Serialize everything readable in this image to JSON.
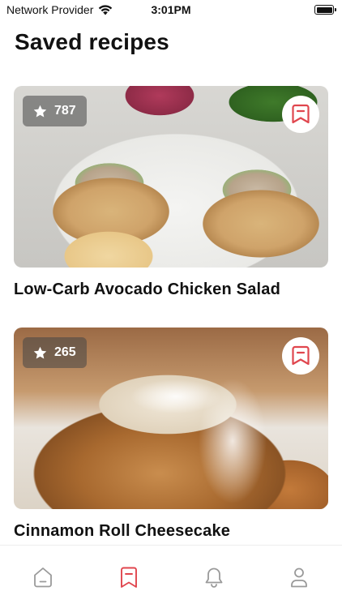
{
  "status_bar": {
    "carrier": "Network Provider",
    "time": "3:01PM",
    "wifi_icon": "wifi-icon",
    "battery_icon": "battery-icon"
  },
  "page": {
    "title": "Saved recipes"
  },
  "recipes": [
    {
      "title": "Low-Carb Avocado Chicken Salad",
      "rating": "787",
      "saved": true,
      "image_icon": "avocado-chicken-salad-photo"
    },
    {
      "title": "Cinnamon Roll Cheesecake",
      "rating": "265",
      "saved": true,
      "image_icon": "cinnamon-roll-cheesecake-photo"
    }
  ],
  "bottom_nav": {
    "items": [
      {
        "icon": "home-icon",
        "active": false
      },
      {
        "icon": "bookmark-icon",
        "active": true
      },
      {
        "icon": "bell-icon",
        "active": false
      },
      {
        "icon": "profile-icon",
        "active": false
      }
    ]
  },
  "colors": {
    "accent": "#e0464e",
    "inactive_icon": "#9a9a9a",
    "text": "#111111",
    "badge_bg": "#464646"
  }
}
